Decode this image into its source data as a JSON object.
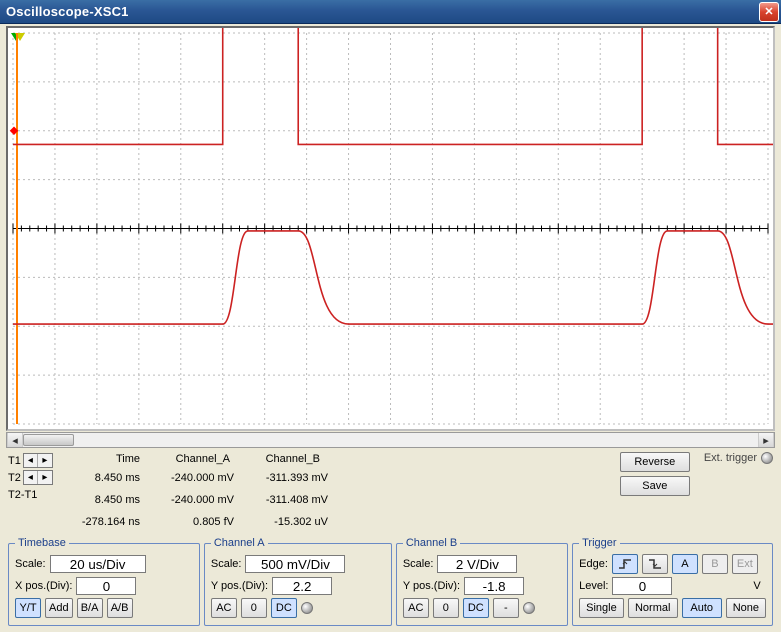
{
  "window": {
    "title": "Oscilloscope-XSC1"
  },
  "scrollbar": {
    "thumb_left_pct": 0,
    "thumb_width_pct": 7
  },
  "cursors": {
    "t1_label": "T1",
    "t2_label": "T2",
    "diff_label": "T2-T1"
  },
  "readout": {
    "headers": {
      "time": "Time",
      "cha": "Channel_A",
      "chb": "Channel_B"
    },
    "t1": {
      "time": "8.450 ms",
      "cha": "-240.000 mV",
      "chb": "-311.393 mV"
    },
    "t2": {
      "time": "8.450 ms",
      "cha": "-240.000 mV",
      "chb": "-311.408 mV"
    },
    "diff": {
      "time": "-278.164 ns",
      "cha": "0.805 fV",
      "chb": "-15.302 uV"
    }
  },
  "buttons": {
    "reverse": "Reverse",
    "save": "Save",
    "ext_trigger": "Ext. trigger"
  },
  "timebase": {
    "legend": "Timebase",
    "scale_label": "Scale:",
    "scale_value": "20 us/Div",
    "xpos_label": "X pos.(Div):",
    "xpos_value": "0",
    "modes": {
      "yt": "Y/T",
      "add": "Add",
      "ba": "B/A",
      "ab": "A/B"
    }
  },
  "channel_a": {
    "legend": "Channel A",
    "scale_label": "Scale:",
    "scale_value": "500 mV/Div",
    "ypos_label": "Y pos.(Div):",
    "ypos_value": "2.2",
    "coupling": {
      "ac": "AC",
      "zero": "0",
      "dc": "DC"
    }
  },
  "channel_b": {
    "legend": "Channel B",
    "scale_label": "Scale:",
    "scale_value": "2 V/Div",
    "ypos_label": "Y pos.(Div):",
    "ypos_value": "-1.8",
    "coupling": {
      "ac": "AC",
      "zero": "0",
      "dc": "DC",
      "minus": "-"
    }
  },
  "trigger": {
    "legend": "Trigger",
    "edge_label": "Edge:",
    "sources": {
      "a": "A",
      "b": "B",
      "ext": "Ext"
    },
    "level_label": "Level:",
    "level_value": "0",
    "level_unit": "V",
    "modes": {
      "single": "Single",
      "normal": "Normal",
      "auto": "Auto",
      "none": "None"
    }
  },
  "chart_data": {
    "type": "line",
    "x_unit": "us",
    "x_per_div": 20,
    "x_divisions": 18,
    "x_range": [
      0,
      360
    ],
    "y_divisions": 8,
    "series": [
      {
        "name": "Channel_A",
        "unit": "mV",
        "scale_per_div": 500,
        "y_pos_div": 2.2,
        "color": "#cc2222",
        "waveform": "square",
        "baseline_mV": -240,
        "high_mV": 1000,
        "period_us": 200,
        "duty_pct": 18,
        "first_rise_us": 100
      },
      {
        "name": "Channel_B",
        "unit": "mV",
        "scale_per_div": 2000,
        "y_pos_div": -1.8,
        "color": "#cc2222",
        "waveform": "pulse-rc",
        "baseline_mV": -311,
        "peak_mV": 3500,
        "period_us": 200,
        "pulse_width_us": 36,
        "rise_us": 12,
        "fall_us": 24,
        "first_rise_us": 100
      }
    ]
  }
}
